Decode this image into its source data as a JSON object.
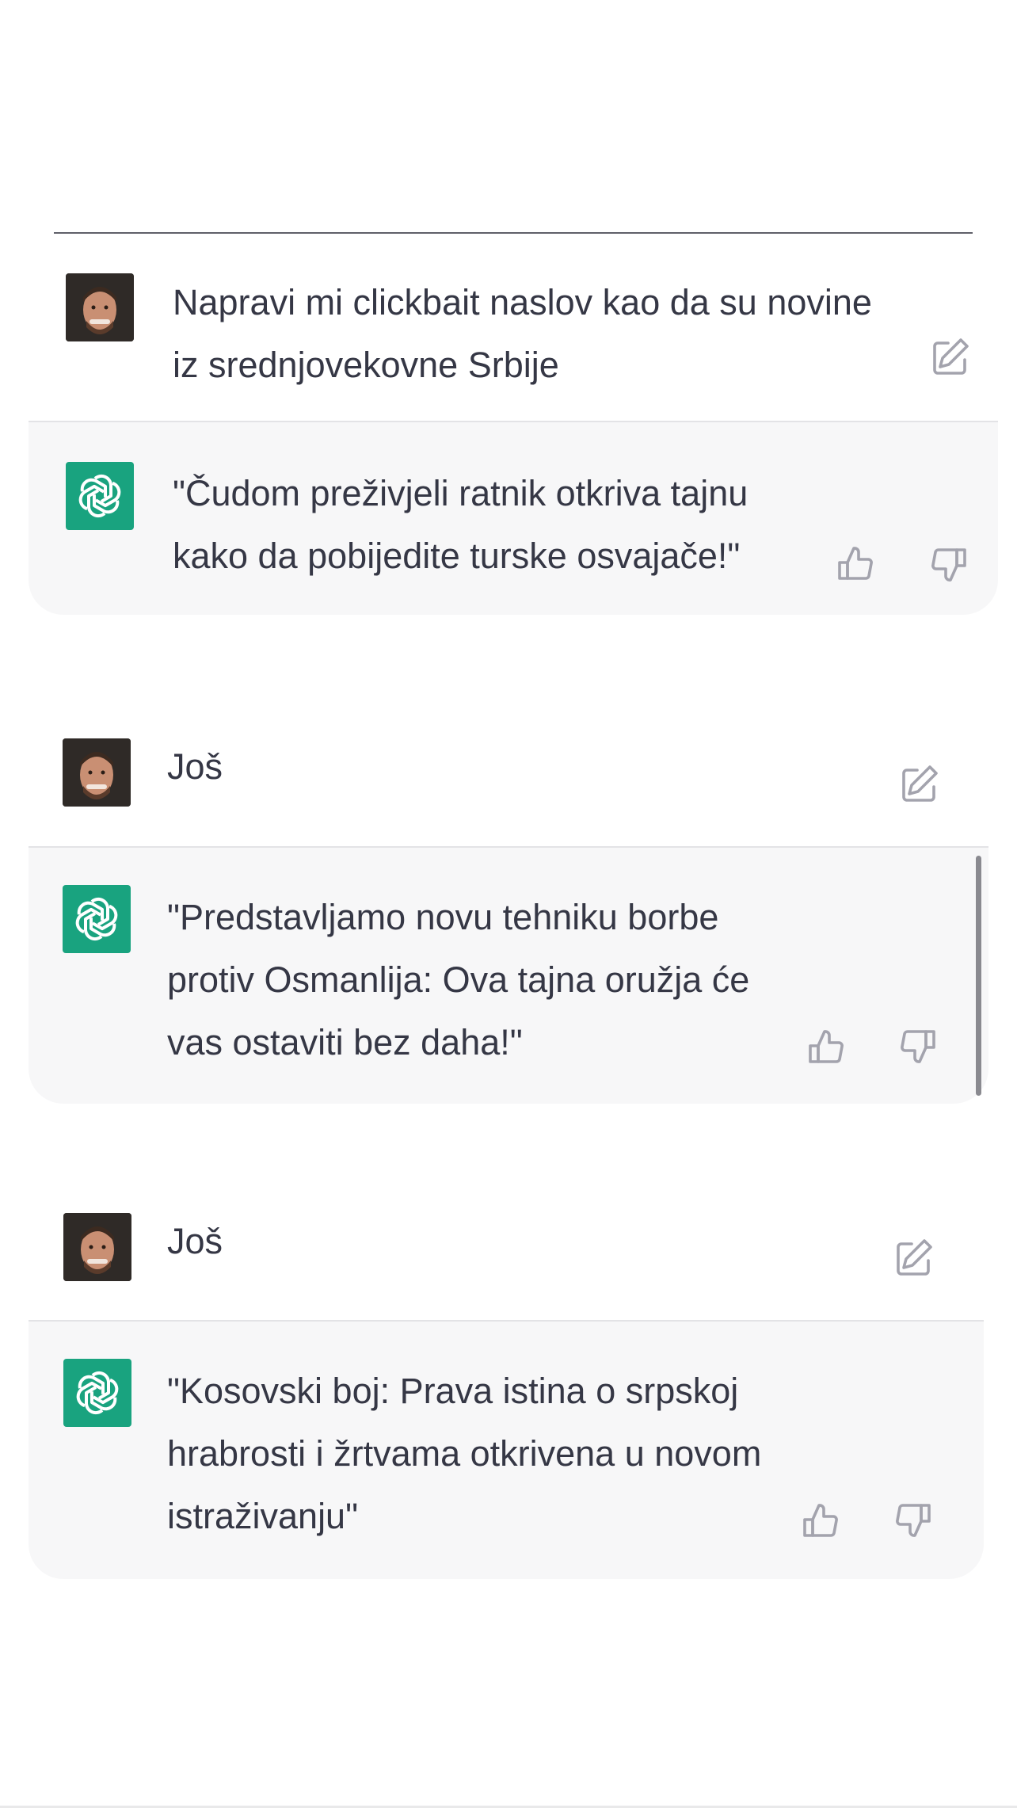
{
  "conversation": {
    "messages": [
      {
        "role": "user",
        "text": "Napravi mi clickbait naslov kao da su novine\niz srednjovekovne Srbije",
        "actions": [
          "edit-icon"
        ]
      },
      {
        "role": "assistant",
        "text": "\"Čudom preživjeli ratnik otkriva tajnu\nkako da pobijedite turske osvajače!\"",
        "actions": [
          "thumbs-up-icon",
          "thumbs-down-icon"
        ]
      },
      {
        "role": "user",
        "text": "Još",
        "actions": [
          "edit-icon"
        ]
      },
      {
        "role": "assistant",
        "text": "\"Predstavljamo novu tehniku borbe\nprotiv Osmanlija: Ova tajna oružja će\nvas ostaviti bez daha!\"",
        "actions": [
          "thumbs-up-icon",
          "thumbs-down-icon"
        ]
      },
      {
        "role": "user",
        "text": "Još",
        "actions": [
          "edit-icon"
        ]
      },
      {
        "role": "assistant",
        "text": "\"Kosovski boj: Prava istina o srpskoj\nhrabrosti i žrtvama otkrivena u novom\nistraživanju\"",
        "actions": [
          "thumbs-up-icon",
          "thumbs-down-icon"
        ]
      }
    ]
  },
  "colors": {
    "assistant_avatar": "#19a37f",
    "assistant_row_bg": "#f7f7f8",
    "text": "#353745",
    "icon": "#a3a3ad"
  }
}
